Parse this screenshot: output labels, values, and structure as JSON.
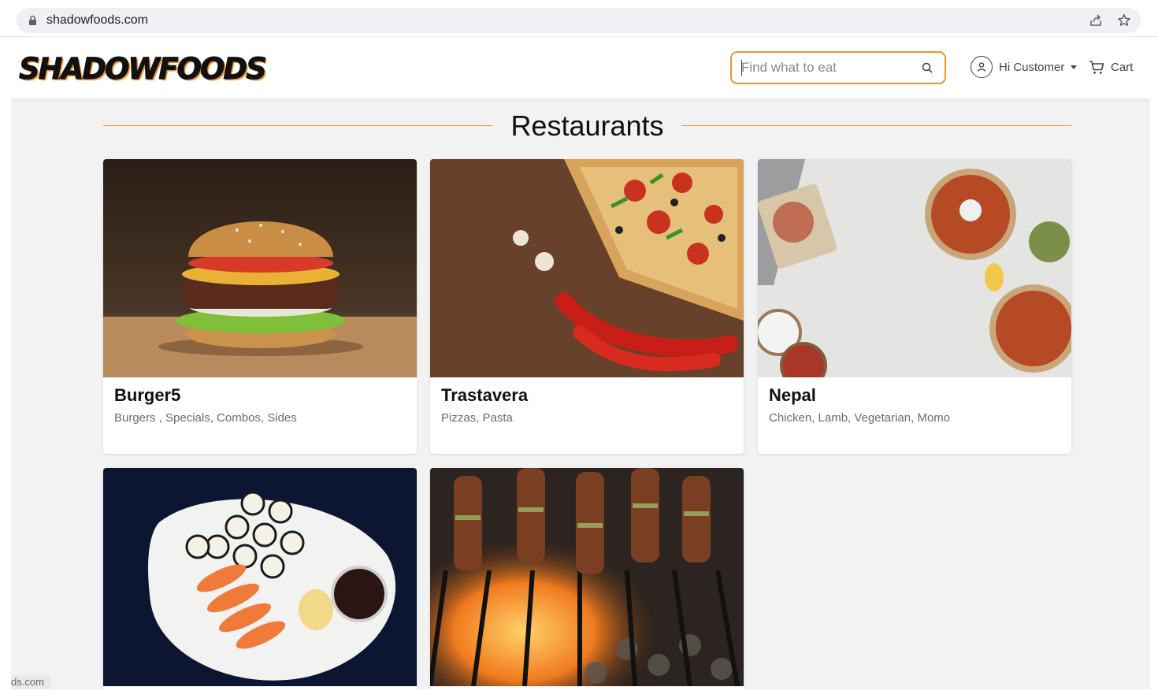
{
  "browser": {
    "url": "shadowfoods.com",
    "icons": [
      "lock-icon",
      "share-icon",
      "star-icon"
    ]
  },
  "nav": {
    "logo_text": "SHADOWFOODS",
    "search_placeholder": "Find what to eat",
    "account_label": "Hi Customer",
    "cart_label": "Cart"
  },
  "section": {
    "title": "Restaurants"
  },
  "restaurants": [
    {
      "name": "Burger5",
      "categories": "Burgers , Specials, Combos, Sides"
    },
    {
      "name": "Trastavera",
      "categories": "Pizzas, Pasta"
    },
    {
      "name": "Nepal",
      "categories": "Chicken, Lamb, Vegetarian, Momo"
    },
    {
      "name": "",
      "categories": ""
    },
    {
      "name": "",
      "categories": ""
    }
  ],
  "status_bar": "ds.com",
  "colors": {
    "accent": "#f0932b",
    "page_background": "#f2f2f2",
    "card_background": "#ffffff"
  }
}
